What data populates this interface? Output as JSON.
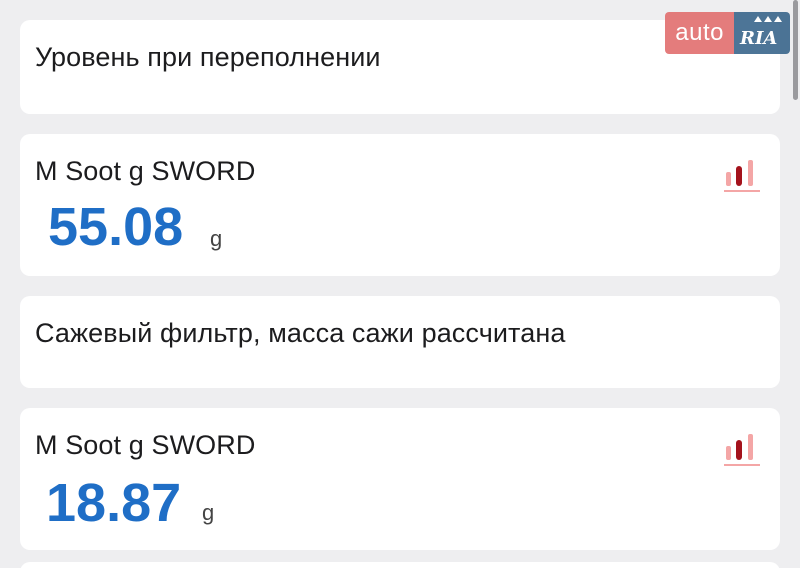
{
  "cards": [
    {
      "label": "Уровень при переполнении"
    },
    {
      "label": "M Soot g SWORD",
      "value": "55.08",
      "unit": "g"
    },
    {
      "label": "Сажевый фильтр, масса сажи рассчитана"
    },
    {
      "label": "M Soot g SWORD",
      "value": "18.87",
      "unit": "g"
    }
  ],
  "watermark": {
    "text_left": "auto",
    "text_right": "RIA"
  },
  "colors": {
    "value": "#1f6ec6",
    "chart_icon_dark": "#a4121c",
    "chart_icon_light": "#f4a6a6",
    "watermark_red": "#e06666",
    "watermark_blue": "#2f5e86"
  },
  "icons": {
    "chart": "bar-chart-icon"
  }
}
